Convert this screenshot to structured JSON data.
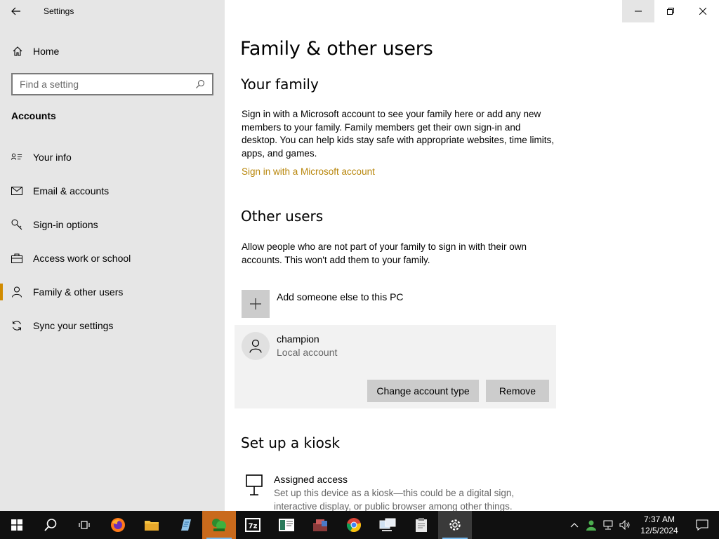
{
  "window": {
    "title": "Settings"
  },
  "sidebar": {
    "home_label": "Home",
    "search_placeholder": "Find a setting",
    "section_title": "Accounts",
    "items": [
      {
        "label": "Your info",
        "icon": "person-card-icon"
      },
      {
        "label": "Email & accounts",
        "icon": "mail-icon"
      },
      {
        "label": "Sign-in options",
        "icon": "key-icon"
      },
      {
        "label": "Access work or school",
        "icon": "briefcase-icon"
      },
      {
        "label": "Family & other users",
        "icon": "person-icon",
        "active": true
      },
      {
        "label": "Sync your settings",
        "icon": "sync-icon"
      }
    ]
  },
  "main": {
    "page_title": "Family & other users",
    "family": {
      "heading": "Your family",
      "description": "Sign in with a Microsoft account to see your family here or add any new members to your family. Family members get their own sign-in and desktop. You can help kids stay safe with appropriate websites, time limits, apps, and games.",
      "link": "Sign in with a Microsoft account"
    },
    "other_users": {
      "heading": "Other users",
      "description": "Allow people who are not part of your family to sign in with their own accounts. This won't add them to your family.",
      "add_label": "Add someone else to this PC",
      "user": {
        "name": "champion",
        "type": "Local account",
        "change_button": "Change account type",
        "remove_button": "Remove"
      }
    },
    "kiosk": {
      "heading": "Set up a kiosk",
      "title": "Assigned access",
      "description": "Set up this device as a kiosk—this could be a digital sign, interactive display, or public browser among other things."
    }
  },
  "taskbar": {
    "time": "7:37 AM",
    "date": "12/5/2024",
    "accent_color": "#d18b00"
  }
}
